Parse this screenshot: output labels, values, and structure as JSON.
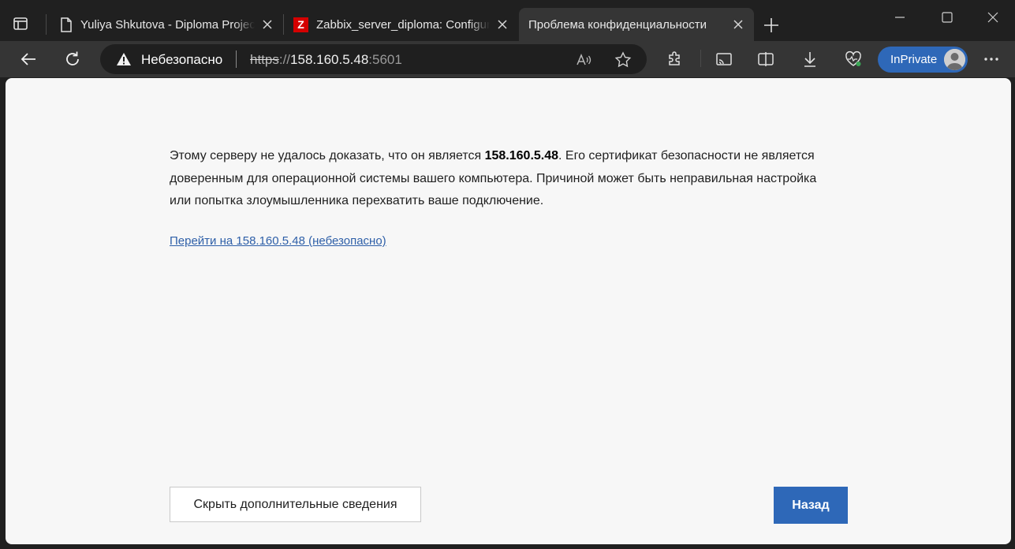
{
  "tabs": [
    {
      "title": "Yuliya Shkutova - Diploma Project",
      "icon": "page-icon"
    },
    {
      "title": "Zabbix_server_diploma: Configuration",
      "icon": "zabbix-favicon",
      "favicon_letter": "Z"
    },
    {
      "title": "Проблема конфиденциальности",
      "active": true
    }
  ],
  "omnibox": {
    "security_label": "Небезопасно",
    "url_scheme": "https",
    "url_sep": "://",
    "url_host": "158.160.5.48",
    "url_port": ":5601"
  },
  "profile": {
    "label": "InPrivate"
  },
  "error": {
    "msg_before": "Этому серверу не удалось доказать, что он является ",
    "msg_host": "158.160.5.48",
    "msg_after": ". Его сертификат безопасности не является доверенным для операционной системы вашего компьютера. Причиной может быть неправильная настройка или попытка злоумышленника перехватить ваше подключение.",
    "proceed_link": "Перейти на 158.160.5.48 (небезопасно)",
    "details_button": "Скрыть дополнительные сведения",
    "back_button": "Назад"
  },
  "colors": {
    "accent": "#2e68b8",
    "link": "#2e5fa8",
    "page_bg": "#f7f7f7",
    "frame": "#202020"
  }
}
